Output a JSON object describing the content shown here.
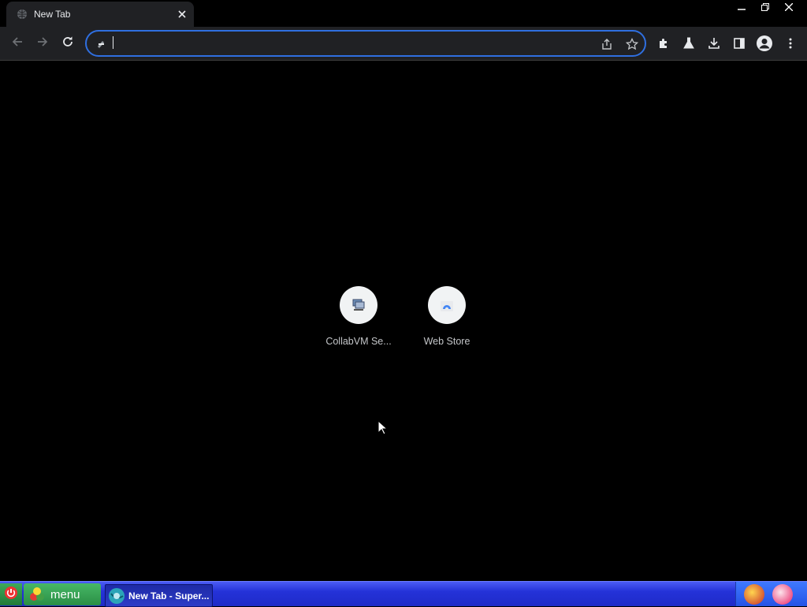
{
  "browser": {
    "tab_title": "New Tab",
    "address_value": "",
    "address_placeholder": ""
  },
  "shortcuts": [
    {
      "label": "CollabVM Se...",
      "icon": "collabvm-icon"
    },
    {
      "label": "Web Store",
      "icon": "web-store-icon"
    }
  ],
  "taskbar": {
    "start_label": "menu",
    "task_label": "New Tab - Super..."
  },
  "colors": {
    "omnibox_focus": "#2f6fe0",
    "toolbar_bg": "#202124",
    "taskbar_bg": "#2432d8",
    "start_green": "#47b866"
  }
}
